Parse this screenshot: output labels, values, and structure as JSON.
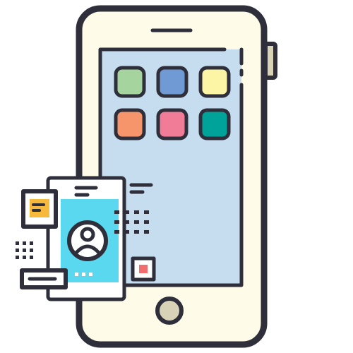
{
  "illustration": {
    "subject": "smartphone-with-contact-card-icon",
    "colors": {
      "outline": "#2e2f3a",
      "phone_body": "#fefbe8",
      "screen": "#c6ddf0",
      "side_button": "#d8d3b6",
      "card_panel": "#5ad8ef",
      "home_button": "#d8d3b6",
      "accent_orange": "#f6b93b",
      "accent_red": "#f26d6d"
    },
    "apps": [
      {
        "name": "app-green",
        "color": "#a6d49f"
      },
      {
        "name": "app-blue",
        "color": "#709ad3"
      },
      {
        "name": "app-yellow",
        "color": "#fdf5a6"
      },
      {
        "name": "app-orange",
        "color": "#f6956b"
      },
      {
        "name": "app-pink",
        "color": "#f07c98"
      },
      {
        "name": "app-teal",
        "color": "#00a39a"
      }
    ],
    "icons": [
      "phone-icon",
      "speaker-icon",
      "home-button-icon",
      "contact-card-icon",
      "user-avatar-icon",
      "note-icon",
      "text-field-icon",
      "stop-icon"
    ]
  }
}
